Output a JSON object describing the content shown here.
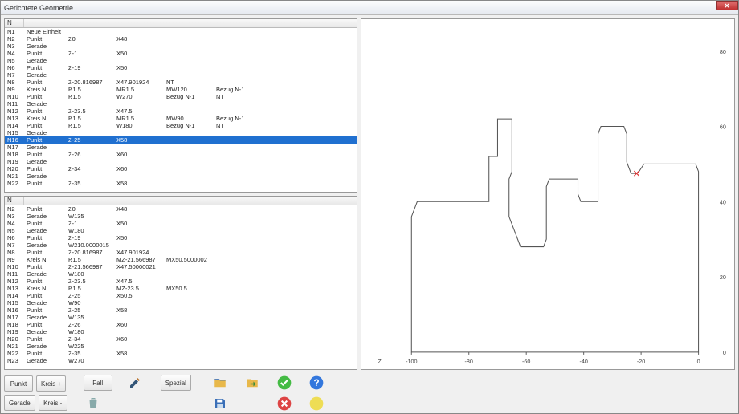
{
  "window": {
    "title": "Gerichtete Geometrie"
  },
  "grid_header": "N",
  "grid_top": [
    [
      "N1",
      "Neue Einheit",
      "",
      "",
      "",
      "",
      ""
    ],
    [
      "N2",
      "Punkt",
      "Z0",
      "X48",
      "",
      "",
      ""
    ],
    [
      "N3",
      "Gerade",
      "",
      "",
      "",
      "",
      ""
    ],
    [
      "N4",
      "Punkt",
      "Z-1",
      "X50",
      "",
      "",
      ""
    ],
    [
      "N5",
      "Gerade",
      "",
      "",
      "",
      "",
      ""
    ],
    [
      "N6",
      "Punkt",
      "Z-19",
      "X50",
      "",
      "",
      ""
    ],
    [
      "N7",
      "Gerade",
      "",
      "",
      "",
      "",
      ""
    ],
    [
      "N8",
      "Punkt",
      "Z-20.816987",
      "X47.901924",
      "NT",
      "",
      ""
    ],
    [
      "N9",
      "Kreis N",
      "R1.5",
      "MR1.5",
      "MW120",
      "Bezug N-1",
      ""
    ],
    [
      "N10",
      "Punkt",
      "R1.5",
      "W270",
      "Bezug N-1",
      "NT",
      ""
    ],
    [
      "N11",
      "Gerade",
      "",
      "",
      "",
      "",
      ""
    ],
    [
      "N12",
      "Punkt",
      "Z-23.5",
      "X47.5",
      "",
      "",
      ""
    ],
    [
      "N13",
      "Kreis N",
      "R1.5",
      "MR1.5",
      "MW90",
      "Bezug N-1",
      ""
    ],
    [
      "N14",
      "Punkt",
      "R1.5",
      "W180",
      "Bezug N-1",
      "NT",
      ""
    ],
    [
      "N15",
      "Gerade",
      "",
      "",
      "",
      "",
      ""
    ],
    [
      "N16",
      "Punkt",
      "Z-25",
      "X58",
      "",
      "",
      ""
    ],
    [
      "N17",
      "Gerade",
      "",
      "",
      "",
      "",
      ""
    ],
    [
      "N18",
      "Punkt",
      "Z-26",
      "X60",
      "",
      "",
      ""
    ],
    [
      "N19",
      "Gerade",
      "",
      "",
      "",
      "",
      ""
    ],
    [
      "N20",
      "Punkt",
      "Z-34",
      "X60",
      "",
      "",
      ""
    ],
    [
      "N21",
      "Gerade",
      "",
      "",
      "",
      "",
      ""
    ],
    [
      "N22",
      "Punkt",
      "Z-35",
      "X58",
      "",
      "",
      ""
    ]
  ],
  "grid_top_selected": 15,
  "grid_bottom": [
    [
      "N2",
      "Punkt",
      "Z0",
      "X48",
      "",
      "",
      ""
    ],
    [
      "N3",
      "Gerade",
      "W135",
      "",
      "",
      "",
      ""
    ],
    [
      "N4",
      "Punkt",
      "Z-1",
      "X50",
      "",
      "",
      ""
    ],
    [
      "N5",
      "Gerade",
      "W180",
      "",
      "",
      "",
      ""
    ],
    [
      "N6",
      "Punkt",
      "Z-19",
      "X50",
      "",
      "",
      ""
    ],
    [
      "N7",
      "Gerade",
      "W210.0000015",
      "",
      "",
      "",
      ""
    ],
    [
      "N8",
      "Punkt",
      "Z-20.816987",
      "X47.901924",
      "",
      "",
      ""
    ],
    [
      "N9",
      "Kreis N",
      "R1.5",
      "MZ-21.566987",
      "MX50.5000002",
      "",
      ""
    ],
    [
      "N10",
      "Punkt",
      "Z-21.566987",
      "X47.50000021",
      "",
      "",
      ""
    ],
    [
      "N11",
      "Gerade",
      "W180",
      "",
      "",
      "",
      ""
    ],
    [
      "N12",
      "Punkt",
      "Z-23.5",
      "X47.5",
      "",
      "",
      ""
    ],
    [
      "N13",
      "Kreis N",
      "R1.5",
      "MZ-23.5",
      "MX50.5",
      "",
      ""
    ],
    [
      "N14",
      "Punkt",
      "Z-25",
      "X50.5",
      "",
      "",
      ""
    ],
    [
      "N15",
      "Gerade",
      "W90",
      "",
      "",
      "",
      ""
    ],
    [
      "N16",
      "Punkt",
      "Z-25",
      "X58",
      "",
      "",
      ""
    ],
    [
      "N17",
      "Gerade",
      "W135",
      "",
      "",
      "",
      ""
    ],
    [
      "N18",
      "Punkt",
      "Z-26",
      "X60",
      "",
      "",
      ""
    ],
    [
      "N19",
      "Gerade",
      "W180",
      "",
      "",
      "",
      ""
    ],
    [
      "N20",
      "Punkt",
      "Z-34",
      "X60",
      "",
      "",
      ""
    ],
    [
      "N21",
      "Gerade",
      "W225",
      "",
      "",
      "",
      ""
    ],
    [
      "N22",
      "Punkt",
      "Z-35",
      "X58",
      "",
      "",
      ""
    ],
    [
      "N23",
      "Gerade",
      "W270",
      "",
      "",
      "",
      ""
    ]
  ],
  "toolbar": {
    "punkt": "Punkt",
    "kreis_plus": "Kreis +",
    "gerade": "Gerade",
    "kreis_minus": "Kreis -",
    "fall": "Fall",
    "spezial": "Spezial"
  },
  "axis": {
    "xlabel": "Z",
    "ticks_x": [
      "-100",
      "-80",
      "-60",
      "-40",
      "-20",
      "0"
    ],
    "ticks_y": [
      "80",
      "60",
      "60",
      "40",
      "20",
      "0"
    ],
    "ylim": [
      0,
      85
    ]
  },
  "chart_data": {
    "type": "line",
    "title": "",
    "xlabel": "Z",
    "ylabel": "",
    "ylim": [
      0,
      85
    ],
    "xlim": [
      -110,
      5
    ],
    "x": [
      0,
      -1,
      -19,
      -20.82,
      -21.57,
      -23.5,
      -25,
      -25,
      -26,
      -34,
      -35,
      -35,
      -41,
      -42,
      -42,
      -52,
      -53,
      -53,
      -54,
      -62,
      -66,
      -66,
      -65,
      -65,
      -70,
      -70,
      -73,
      -73,
      -98,
      -100,
      -100,
      0,
      0
    ],
    "y": [
      48,
      50,
      50,
      47.9,
      47.5,
      47.5,
      50.5,
      58,
      60,
      60,
      58,
      40,
      40,
      42,
      46,
      46,
      44,
      30,
      28,
      28,
      36,
      46,
      48,
      62,
      62,
      52,
      52,
      40,
      40,
      36,
      0,
      0,
      48
    ],
    "marker": {
      "x": -21.57,
      "y": 47.5
    }
  }
}
